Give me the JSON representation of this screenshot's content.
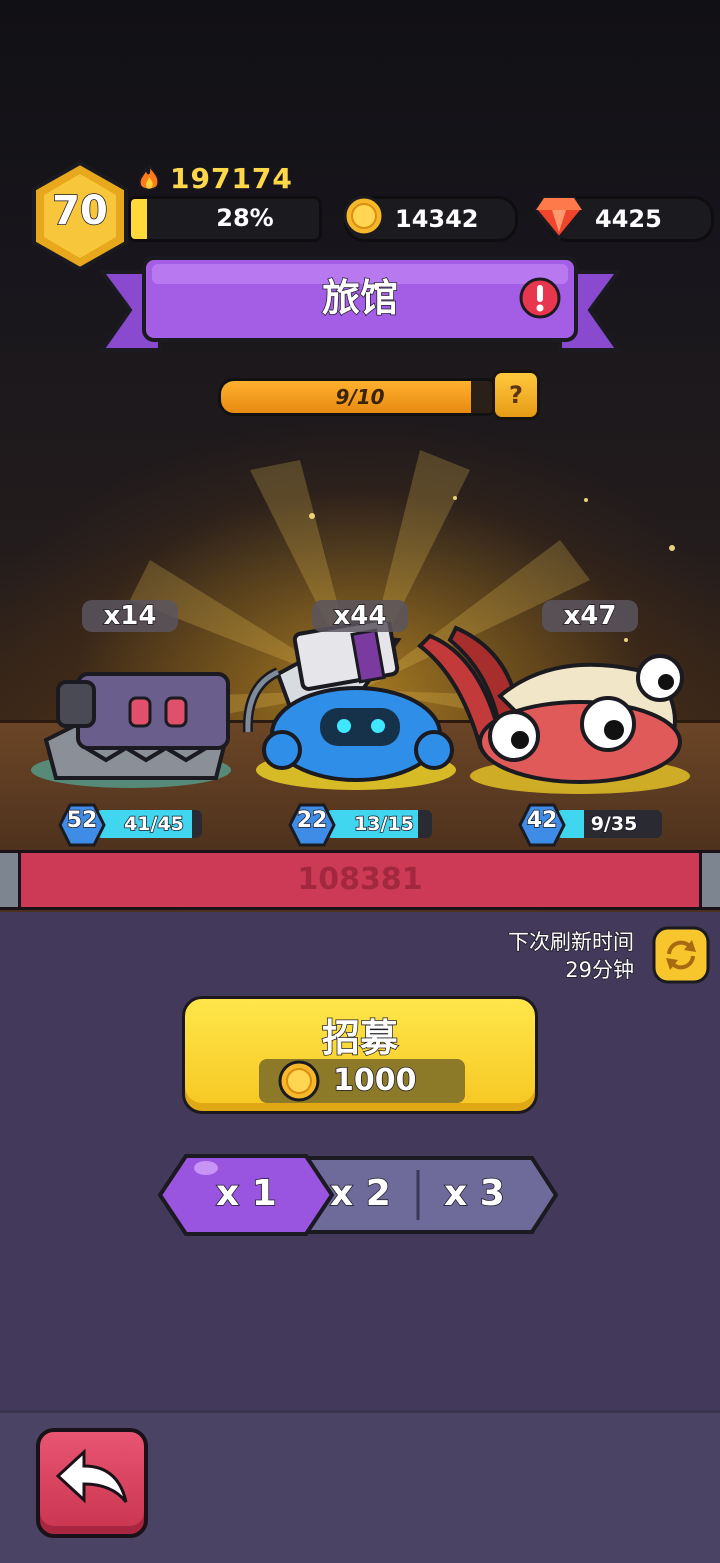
{
  "hud": {
    "level": "70",
    "power": "197174",
    "xp_percent_text": "28%",
    "xp_fraction": 0.28,
    "coins": "14342",
    "gems": "4425"
  },
  "banner": {
    "title": "旅馆"
  },
  "progress": {
    "text": "9/10",
    "fraction": 0.9,
    "help_label": "?"
  },
  "heroes": [
    {
      "count": "x14",
      "level": "52",
      "shards": "41/45",
      "fraction": 0.91
    },
    {
      "count": "x44",
      "level": "22",
      "shards": "13/15",
      "fraction": 0.87
    },
    {
      "count": "x47",
      "level": "42",
      "shards": "9/35",
      "fraction": 0.26
    }
  ],
  "hp_bar_text": "108381",
  "refresh": {
    "line1": "下次刷新时间",
    "line2": "29分钟"
  },
  "recruit": {
    "label": "招募",
    "cost": "1000"
  },
  "multipliers": {
    "options": [
      "x 1",
      "x 2",
      "x 3"
    ],
    "selected": "x 1"
  },
  "colors": {
    "accent_purple": "#9a55e0",
    "recruit_yellow": "#f9d43a",
    "back_red": "#d63d5b",
    "shard_cyan": "#40d6f0"
  }
}
